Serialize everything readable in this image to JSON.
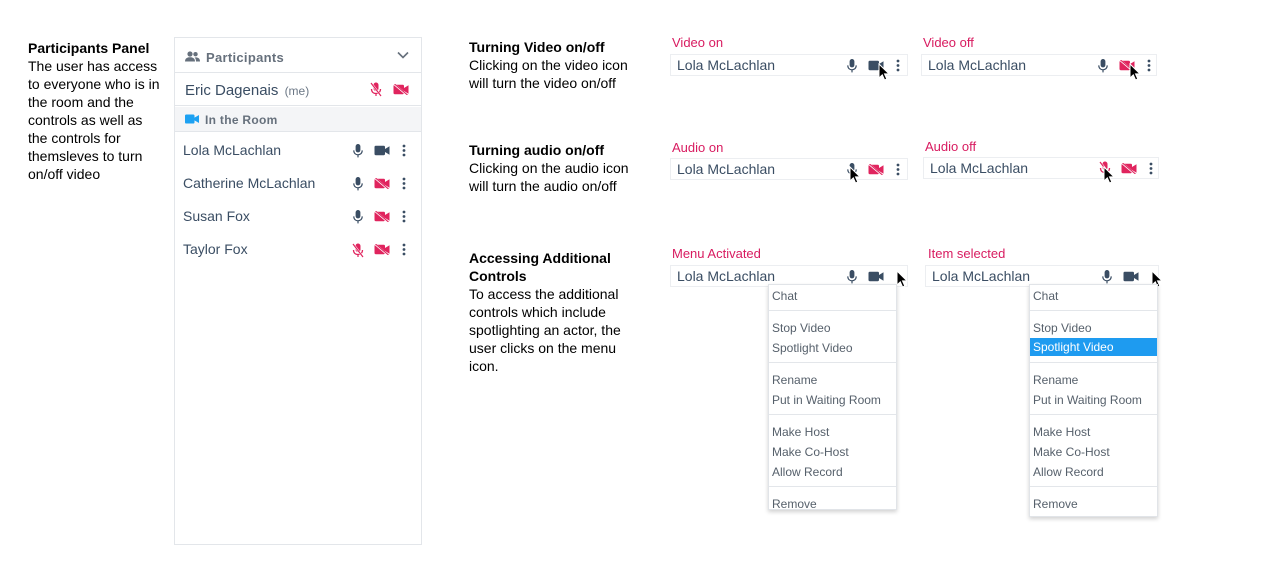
{
  "colors": {
    "accent_pink": "#d81b60",
    "icon_dark": "#3a4d63",
    "icon_muted_red": "#e0245e",
    "video_blue": "#1da1f2",
    "selection_blue": "#1e9bf0"
  },
  "intro": {
    "title": "Participants Panel",
    "lines": [
      "The user has access",
      "to everyone who is in",
      "the room and the",
      "controls as well as",
      "the controls for",
      "themsleves to turn",
      "on/off video"
    ]
  },
  "panel": {
    "header_title": "Participants",
    "header_icon": "people-icon",
    "collapse_icon": "chevron-down-icon",
    "me": {
      "name": "Eric Dagenais",
      "suffix": "(me)"
    },
    "room_label": "In the Room",
    "participants": [
      {
        "name": "Lola McLachlan",
        "mic": "on",
        "video": "on"
      },
      {
        "name": "Catherine McLachlan",
        "mic": "on",
        "video": "off"
      },
      {
        "name": "Susan Fox",
        "mic": "on",
        "video": "off"
      },
      {
        "name": "Taylor Fox",
        "mic": "off",
        "video": "off"
      }
    ]
  },
  "sections": {
    "video": {
      "title": "Turning Video on/off",
      "lines": [
        "Clicking on the video icon",
        "will turn the video on/off"
      ],
      "on_label": "Video on",
      "off_label": "Video off",
      "name": "Lola McLachlan"
    },
    "audio": {
      "title": "Turning audio on/off",
      "lines": [
        "Clicking on the audio icon",
        "will turn the audio on/off"
      ],
      "on_label": "Audio on",
      "off_label": "Audio off",
      "name": "Lola McLachlan"
    },
    "controls": {
      "title_lines": [
        "Accessing Additional",
        "Controls"
      ],
      "lines": [
        "To access the additional",
        "controls which include",
        "spotlighting an actor, the",
        "user clicks on the menu",
        "icon."
      ],
      "activated_label": "Menu Activated",
      "selected_label": "Item selected",
      "name": "Lola McLachlan"
    }
  },
  "menu": {
    "groups": [
      [
        "Chat"
      ],
      [
        "Stop Video",
        "Spotlight Video"
      ],
      [
        "Rename",
        "Put in Waiting Room"
      ],
      [
        "Make Host",
        "Make Co-Host",
        "Allow Record"
      ],
      [
        "Remove"
      ]
    ],
    "items": [
      "Chat",
      "Stop Video",
      "Spotlight Video",
      "Rename",
      "Put in Waiting Room",
      "Make Host",
      "Make Co-Host",
      "Allow Record",
      "Remove"
    ],
    "selected_item": "Spotlight Video"
  }
}
